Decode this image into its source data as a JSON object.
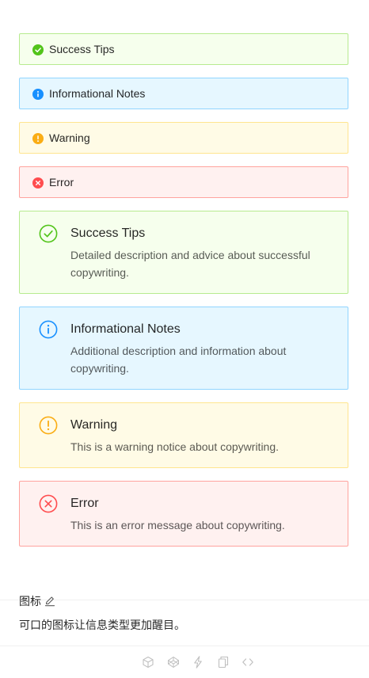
{
  "alerts_small": [
    {
      "type": "success",
      "message": "Success Tips",
      "icon": "check-circle-filled-icon",
      "color": "#52c41a"
    },
    {
      "type": "info",
      "message": "Informational Notes",
      "icon": "info-circle-filled-icon",
      "color": "#1890ff"
    },
    {
      "type": "warning",
      "message": "Warning",
      "icon": "exclamation-circle-filled-icon",
      "color": "#faad14"
    },
    {
      "type": "error",
      "message": "Error",
      "icon": "close-circle-filled-icon",
      "color": "#ff4d4f"
    }
  ],
  "alerts_large": [
    {
      "type": "success",
      "message": "Success Tips",
      "description": "Detailed description and advice about successful copywriting.",
      "icon": "check-circle-outline-icon",
      "color": "#52c41a"
    },
    {
      "type": "info",
      "message": "Informational Notes",
      "description": "Additional description and information about copywriting.",
      "icon": "info-circle-outline-icon",
      "color": "#1890ff"
    },
    {
      "type": "warning",
      "message": "Warning",
      "description": "This is a warning notice about copywriting.",
      "icon": "exclamation-circle-outline-icon",
      "color": "#faad14"
    },
    {
      "type": "error",
      "message": "Error",
      "description": "This is an error message about copywriting.",
      "icon": "close-circle-outline-icon",
      "color": "#ff4d4f"
    }
  ],
  "meta": {
    "title": "图标",
    "description": "可口的图标让信息类型更加醒目。",
    "edit_icon": "edit-icon"
  },
  "toolbar": {
    "icons": [
      "codesandbox-icon",
      "codepen-icon",
      "thunderbolt-icon",
      "copy-icon",
      "code-icon"
    ]
  }
}
